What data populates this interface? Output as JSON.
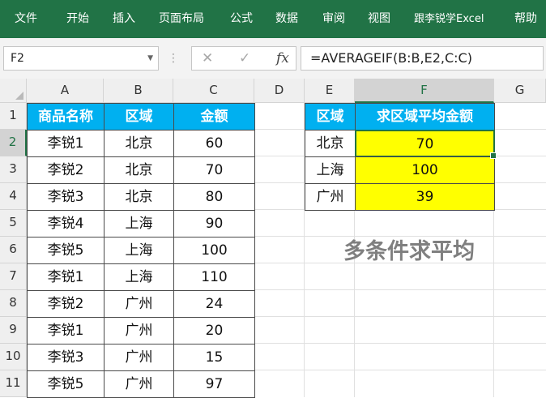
{
  "ribbon": {
    "tabs": [
      "文件",
      "开始",
      "插入",
      "页面布局",
      "公式",
      "数据",
      "审阅",
      "视图",
      "跟李锐学Excel",
      "帮助"
    ],
    "accent": "#217346"
  },
  "formula_bar": {
    "name_box": "F2",
    "cancel_icon": "✕",
    "enter_icon": "✓",
    "fx_label": "fx",
    "formula": "=AVERAGEIF(B:B,E2,C:C)"
  },
  "columns": [
    "A",
    "B",
    "C",
    "D",
    "E",
    "F",
    "G"
  ],
  "selected_column": "F",
  "rows": [
    "1",
    "2",
    "3",
    "4",
    "5",
    "6",
    "7",
    "8",
    "9",
    "10",
    "11"
  ],
  "selected_row": "2",
  "source_table": {
    "headers": [
      "商品名称",
      "区域",
      "金额"
    ],
    "rows": [
      [
        "李锐1",
        "北京",
        "60"
      ],
      [
        "李锐2",
        "北京",
        "70"
      ],
      [
        "李锐3",
        "北京",
        "80"
      ],
      [
        "李锐4",
        "上海",
        "90"
      ],
      [
        "李锐5",
        "上海",
        "100"
      ],
      [
        "李锐1",
        "上海",
        "110"
      ],
      [
        "李锐2",
        "广州",
        "24"
      ],
      [
        "李锐1",
        "广州",
        "20"
      ],
      [
        "李锐3",
        "广州",
        "15"
      ],
      [
        "李锐5",
        "广州",
        "97"
      ]
    ]
  },
  "result_table": {
    "headers": [
      "区域",
      "求区域平均金额"
    ],
    "rows": [
      [
        "北京",
        "70"
      ],
      [
        "上海",
        "100"
      ],
      [
        "广州",
        "39"
      ]
    ]
  },
  "annotation": "多条件求平均",
  "colors": {
    "header_fill": "#00b0f0",
    "result_fill": "#ffff00",
    "annotation": "#7f7f7f"
  }
}
